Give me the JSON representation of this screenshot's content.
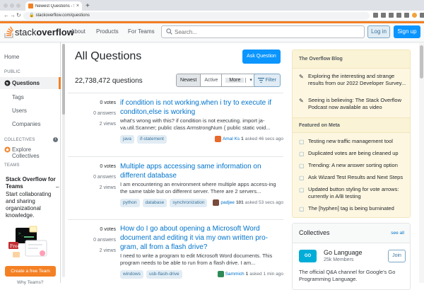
{
  "browser": {
    "tab_title": "Newest Questions - Stack Ov",
    "tab_close": "×",
    "new_tab": "+",
    "url": "stackoverflow.com/questions",
    "back": "←",
    "forward": "→",
    "reload": "↻"
  },
  "header": {
    "logo_word1": "stack",
    "logo_word2": "overflow",
    "nav": [
      "About",
      "Products",
      "For Teams"
    ],
    "search_placeholder": "Search...",
    "login": "Log in",
    "signup": "Sign up"
  },
  "leftnav": {
    "home": "Home",
    "public": "PUBLIC",
    "questions": "Questions",
    "tags": "Tags",
    "users": "Users",
    "companies": "Companies",
    "collectives": "COLLECTIVES",
    "explore_collectives": "Explore Collectives",
    "teams": "TEAMS",
    "teams_title": "Stack Overflow for Teams",
    "teams_desc": " – Start collaborating and sharing organizational knowledge.",
    "create_team": "Create a free Team",
    "why_teams": "Why Teams?"
  },
  "main": {
    "title": "All Questions",
    "ask_button": "Ask Question",
    "count": "22,738,472 questions",
    "filters": [
      "Newest",
      "Active",
      "More"
    ],
    "filter_button": "Filter",
    "questions": [
      {
        "votes": "0 votes",
        "answers": "0 answers",
        "views": "2 views",
        "title": "if condition is not working.when i try to execute if conditon,else is working",
        "excerpt": "what's wrong with this? if condition is not executing. import ja-va.util.Scanner; public class ArmstrongNum { public static void...",
        "tags": [
          "java",
          "if-statement"
        ],
        "user": "Amal Ks",
        "rep": "1",
        "time": "asked 46 secs ago",
        "avatar_color": "#e8692b"
      },
      {
        "votes": "0 votes",
        "answers": "0 answers",
        "views": "2 views",
        "title": "Multiple apps accessing same information on different database",
        "excerpt": "I am encountering an environment where multiple apps access-ing the same table but on different server. There are 2 servers...",
        "tags": [
          "python",
          "database",
          "synchronization"
        ],
        "user": "padjee",
        "rep": "101",
        "time": "asked 53 secs ago",
        "avatar_color": "#7a4a3a"
      },
      {
        "votes": "0 votes",
        "answers": "0 answers",
        "views": "2 views",
        "title": "How do I go about opening a Microsoft Word document and editing it via my own written pro-gram, all from a flash drive?",
        "excerpt": "I need to write a program to edit Microsoft Word documents. This program needs to be able to run from a flash drive. I am...",
        "tags": [
          "windows",
          "usb-flash-drive"
        ],
        "user": "Sammich",
        "rep": "1",
        "time": "asked 1 min ago",
        "avatar_color": "#2e8b57"
      }
    ]
  },
  "sidebar": {
    "blog_title": "The Overflow Blog",
    "blog_items": [
      "Exploring the interesting and strange results from our 2022 Developer Survey...",
      "Seeing is believing: The Stack Overflow Podcast now available as video"
    ],
    "meta_title": "Featured on Meta",
    "meta_items": [
      "Testing new traffic management tool",
      "Duplicated votes are being cleaned up",
      "Trending: A new answer sorting option",
      "Ask Wizard Test Results and Next Steps",
      "Updated button styling for vote arrows: currently in A/B testing",
      "The [hyphen] tag is being burninated"
    ],
    "collectives_title": "Collectives",
    "see_all": "see all",
    "go_badge": "GO",
    "go_name": "Go Language",
    "go_members": "25k Members",
    "join": "Join",
    "go_desc": "The official Q&A channel for Google's Go Programming Language."
  },
  "colors": {
    "accent": "#f48024",
    "link": "#0074cc",
    "primary_button": "#0a95ff"
  }
}
